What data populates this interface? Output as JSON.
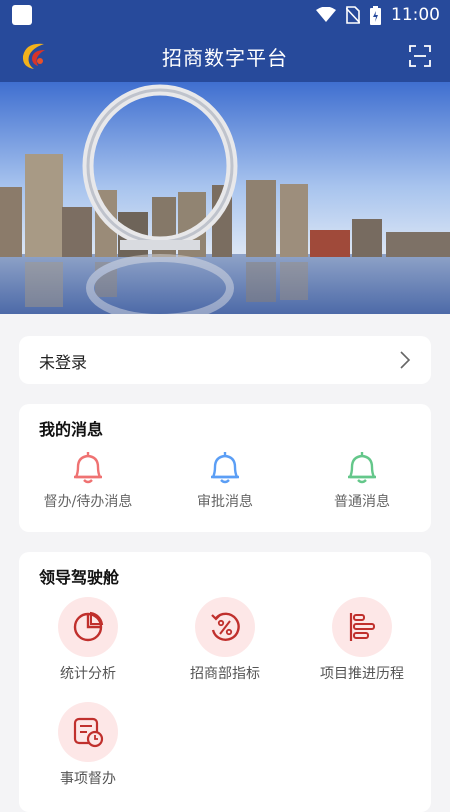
{
  "status_bar": {
    "time": "11:00",
    "icons": [
      "wifi-icon",
      "no-sim-icon",
      "battery-charging-icon"
    ]
  },
  "app_bar": {
    "title": "招商数字平台",
    "logo_icon": "phoenix-logo",
    "scan_icon": "scan-icon"
  },
  "banner": {
    "image": "city-skyline-ring-banner"
  },
  "login": {
    "label": "未登录",
    "arrow_icon": "chevron-right-icon"
  },
  "messages": {
    "title": "我的消息",
    "items": [
      {
        "label": "督办/待办消息",
        "icon": "bell-icon",
        "color": "#ef7272"
      },
      {
        "label": "审批消息",
        "icon": "bell-icon",
        "color": "#5b9ef5"
      },
      {
        "label": "普通消息",
        "icon": "bell-icon",
        "color": "#64c78a"
      }
    ]
  },
  "cockpit": {
    "title": "领导驾驶舱",
    "items": [
      {
        "label": "统计分析",
        "icon": "pie-chart-icon"
      },
      {
        "label": "招商部指标",
        "icon": "percent-cycle-icon"
      },
      {
        "label": "项目推进历程",
        "icon": "timeline-icon"
      },
      {
        "label": "事项督办",
        "icon": "document-clock-icon"
      }
    ],
    "icon_color": "#c0302d",
    "icon_bg": "#fde7e7"
  }
}
